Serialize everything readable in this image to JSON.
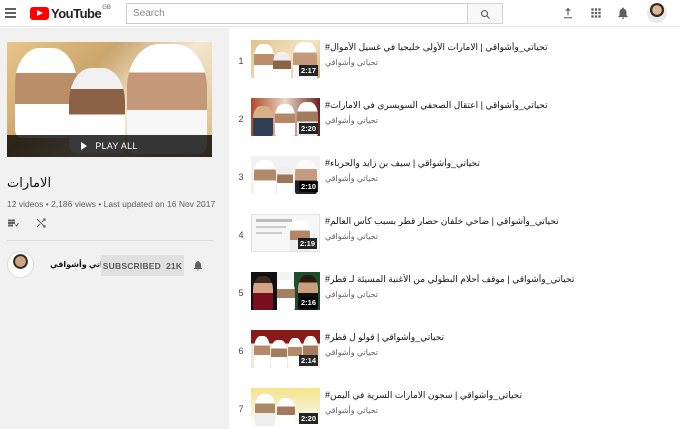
{
  "header": {
    "logo_text": "YouTube",
    "logo_region": "GB",
    "search_placeholder": "Search"
  },
  "playlist": {
    "play_all_label": "PLAY ALL",
    "title": "الامارات",
    "stats": "12 videos • 2,186 views • Last updated on 16 Nov 2017",
    "owner_name": "تحياتي وأشواقي",
    "subscribe_label": "SUBSCRIBED",
    "subscriber_count": "21K"
  },
  "videos": [
    {
      "index": "1",
      "title": "تحياتي_وأشواقي | الامارات الأولى خليجيا في غسيل الأموال#",
      "channel": "تحياتي وأشواقي",
      "duration": "2:17"
    },
    {
      "index": "2",
      "title": "تحياتي_وأشواقي | اعتقال الصحفي السويسري في الامارات#",
      "channel": "تحياتي وأشواقي",
      "duration": "2:20"
    },
    {
      "index": "3",
      "title": "تحياتي_وأشواقي | سيف بن زايد والحرباء#",
      "channel": "تحياتي وأشواقي",
      "duration": "2:10"
    },
    {
      "index": "4",
      "title": "تحياتي_وأشواقي | ضاحي خلفان حصار قطر بسبب كأس العالم#",
      "channel": "تحياتي وأشواقي",
      "duration": "2:19"
    },
    {
      "index": "5",
      "title": "تحياتي_وأشواقي | موقف أحلام البطولي من الأغنية المسيئة لـ قطر#",
      "channel": "تحياتي وأشواقي",
      "duration": "2:16"
    },
    {
      "index": "6",
      "title": "تحياتي_وأشواقي | قولو ل قطر#",
      "channel": "تحياتي وأشواقي",
      "duration": "2:14"
    },
    {
      "index": "7",
      "title": "تحياتي_وأشواقي | سجون الامارات السرية في اليمن#",
      "channel": "تحياتي وأشواقي",
      "duration": "2:20"
    }
  ],
  "colors": {
    "brand_red": "#ff0000",
    "sidebar_bg": "#f1f1f1",
    "subscribed_bg": "#e0e0e0"
  },
  "icons": [
    "menu-icon",
    "youtube-logo-icon",
    "search-icon",
    "upload-icon",
    "apps-icon",
    "notifications-icon",
    "sort-icon",
    "shuffle-icon",
    "bell-icon",
    "play-icon"
  ]
}
